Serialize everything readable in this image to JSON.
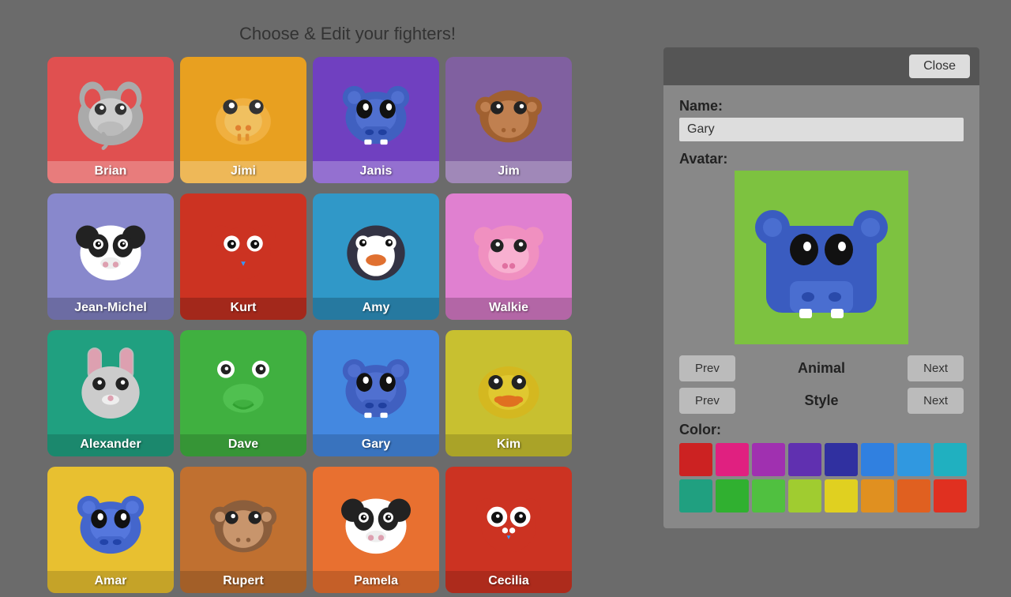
{
  "title": "Choose & Edit your fighters!",
  "fighters": [
    {
      "name": "Brian",
      "color": "#e05050",
      "animal": "elephant",
      "nameColor": "#e05050"
    },
    {
      "name": "Jimi",
      "color": "#e8a020",
      "animal": "giraffe",
      "nameColor": "#e8a020"
    },
    {
      "name": "Janis",
      "color": "#7040c0",
      "animal": "hippo-blue",
      "nameColor": "#7040c0"
    },
    {
      "name": "Jim",
      "color": "#8060a0",
      "animal": "monkey",
      "nameColor": "#8060a0"
    },
    {
      "name": "Jean-Michel",
      "color": "#8888cc",
      "animal": "panda",
      "nameColor": "#8888cc"
    },
    {
      "name": "Kurt",
      "color": "#cc3322",
      "animal": "bird-red",
      "nameColor": "#cc3322"
    },
    {
      "name": "Amy",
      "color": "#3098c8",
      "animal": "penguin",
      "nameColor": "#3098c8"
    },
    {
      "name": "Walkie",
      "color": "#e080d0",
      "animal": "pig",
      "nameColor": "#e080d0"
    },
    {
      "name": "Alexander",
      "color": "#20a080",
      "animal": "rabbit",
      "nameColor": "#20a080"
    },
    {
      "name": "Dave",
      "color": "#40b040",
      "animal": "frog",
      "nameColor": "#40b040"
    },
    {
      "name": "Gary",
      "color": "#4488e0",
      "animal": "hippo-blue",
      "nameColor": "#4488e0"
    },
    {
      "name": "Kim",
      "color": "#c8c030",
      "animal": "duck",
      "nameColor": "#c8c030"
    },
    {
      "name": "Amar",
      "color": "#e8c030",
      "animal": "hippo-blue-small",
      "nameColor": "#e8c030"
    },
    {
      "name": "Rupert",
      "color": "#c07030",
      "animal": "monkey-brown",
      "nameColor": "#c07030"
    },
    {
      "name": "Pamela",
      "color": "#e87030",
      "animal": "panda",
      "nameColor": "#e87030"
    },
    {
      "name": "Cecilia",
      "color": "#cc3322",
      "animal": "bird-owl",
      "nameColor": "#cc3322"
    }
  ],
  "panel": {
    "close_label": "Close",
    "name_label": "Name:",
    "name_value": "Gary",
    "avatar_label": "Avatar:",
    "animal_label": "Animal",
    "style_label": "Style",
    "prev_label": "Prev",
    "next_label": "Next",
    "color_label": "Color:",
    "colors": [
      "#cc2222",
      "#e02080",
      "#a030b0",
      "#6030b0",
      "#3030a0",
      "#3080e0",
      "#3098e0",
      "#20b0c0",
      "#20a080",
      "#30b030",
      "#50c040",
      "#a0cc30",
      "#e0d020",
      "#e09020",
      "#e06020",
      "#e03020"
    ]
  },
  "bgColor": "#6b6b6b"
}
